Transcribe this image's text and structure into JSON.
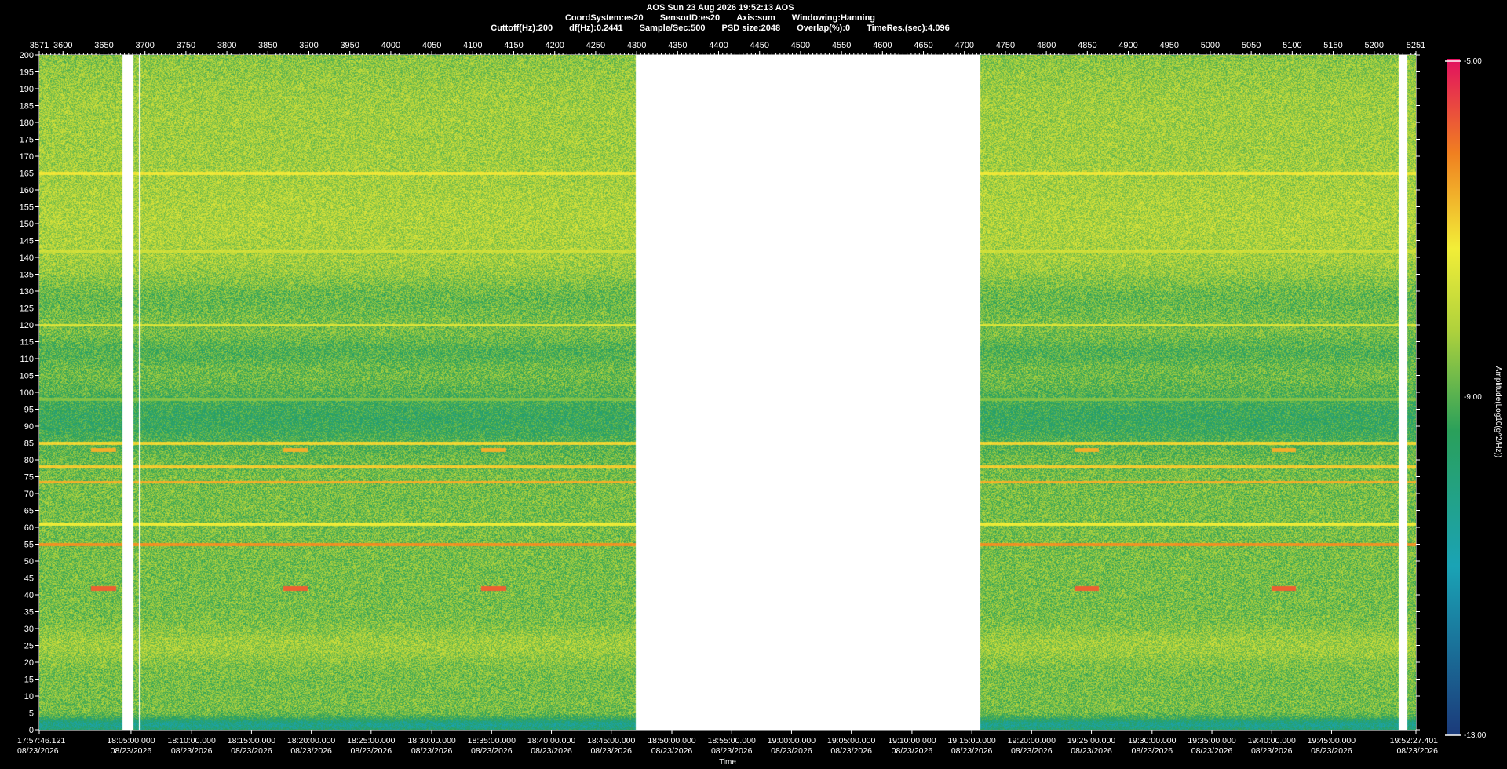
{
  "header": {
    "title": "AOS  Sun 23 Aug 2026 19:52:13  AOS",
    "row2": [
      "CoordSystem:es20",
      "SensorID:es20",
      "Axis:sum",
      "Windowing:Hanning"
    ],
    "row3": [
      "Cuttoff(Hz):200",
      "df(Hz):0.2441",
      "Sample/Sec:500",
      "PSD size:2048",
      "Overlap(%):0",
      "TimeRes.(sec):4.096"
    ]
  },
  "chart_data": {
    "type": "heatmap",
    "xlabel": "Time",
    "ylabel": "",
    "colorbar_label": "Amplitude(Log10(g^2/Hz))",
    "colorbar_ticks": [
      "-5.00",
      "-9.00",
      "-13.00"
    ],
    "zlim": [
      -13,
      -5
    ],
    "ylim": [
      0,
      200
    ],
    "y_ticks": [
      0,
      5,
      10,
      15,
      20,
      25,
      30,
      35,
      40,
      45,
      50,
      55,
      60,
      65,
      70,
      75,
      80,
      85,
      90,
      95,
      100,
      105,
      110,
      115,
      120,
      125,
      130,
      135,
      140,
      145,
      150,
      155,
      160,
      165,
      170,
      175,
      180,
      185,
      190,
      195,
      200
    ],
    "x_top_range": [
      3571,
      5251
    ],
    "x_top_ticks": [
      "3571",
      "3600",
      "3650",
      "3700",
      "3750",
      "3800",
      "3850",
      "3900",
      "3950",
      "4000",
      "4050",
      "4100",
      "4150",
      "4200",
      "4250",
      "4300",
      "4350",
      "4400",
      "4450",
      "4500",
      "4550",
      "4600",
      "4650",
      "4700",
      "4750",
      "4800",
      "4850",
      "4900",
      "4950",
      "5000",
      "5050",
      "5100",
      "5150",
      "5200",
      "5251"
    ],
    "x_bottom_ticks": [
      {
        "idx": 3571,
        "time": "17:57:46.121",
        "date": "08/23/2026"
      },
      {
        "idx": 3683,
        "time": "18:05:00.000",
        "date": "08/23/2026"
      },
      {
        "idx": 3757,
        "time": "18:10:00.000",
        "date": "08/23/2026"
      },
      {
        "idx": 3830,
        "time": "18:15:00.000",
        "date": "08/23/2026"
      },
      {
        "idx": 3903,
        "time": "18:20:00.000",
        "date": "08/23/2026"
      },
      {
        "idx": 3976,
        "time": "18:25:00.000",
        "date": "08/23/2026"
      },
      {
        "idx": 4050,
        "time": "18:30:00.000",
        "date": "08/23/2026"
      },
      {
        "idx": 4123,
        "time": "18:35:00.000",
        "date": "08/23/2026"
      },
      {
        "idx": 4196,
        "time": "18:40:00.000",
        "date": "08/23/2026"
      },
      {
        "idx": 4269,
        "time": "18:45:00.000",
        "date": "08/23/2026"
      },
      {
        "idx": 4343,
        "time": "18:50:00.000",
        "date": "08/23/2026"
      },
      {
        "idx": 4416,
        "time": "18:55:00.000",
        "date": "08/23/2026"
      },
      {
        "idx": 4489,
        "time": "19:00:00.000",
        "date": "08/23/2026"
      },
      {
        "idx": 4562,
        "time": "19:05:00.000",
        "date": "08/23/2026"
      },
      {
        "idx": 4636,
        "time": "19:10:00.000",
        "date": "08/23/2026"
      },
      {
        "idx": 4709,
        "time": "19:15:00.000",
        "date": "08/23/2026"
      },
      {
        "idx": 4782,
        "time": "19:20:00.000",
        "date": "08/23/2026"
      },
      {
        "idx": 4855,
        "time": "19:25:00.000",
        "date": "08/23/2026"
      },
      {
        "idx": 4929,
        "time": "19:30:00.000",
        "date": "08/23/2026"
      },
      {
        "idx": 5002,
        "time": "19:35:00.000",
        "date": "08/23/2026"
      },
      {
        "idx": 5075,
        "time": "19:40:00.000",
        "date": "08/23/2026"
      },
      {
        "idx": 5148,
        "time": "19:45:00.000",
        "date": "08/23/2026"
      },
      {
        "idx": 5251,
        "time": "19:52:27.401",
        "date": "08/23/2026"
      }
    ],
    "data_gaps": [
      [
        3672,
        3685
      ],
      [
        3692,
        3694
      ],
      [
        4298,
        4719
      ],
      [
        5229,
        5240
      ]
    ],
    "spectral_lines_hz": [
      {
        "hz": 165,
        "level": -7.2
      },
      {
        "hz": 142,
        "level": -7.8
      },
      {
        "hz": 120,
        "level": -7.6
      },
      {
        "hz": 98,
        "level": -8.6
      },
      {
        "hz": 85,
        "level": -7.0
      },
      {
        "hz": 78,
        "level": -6.9
      },
      {
        "hz": 73.5,
        "level": -6.6
      },
      {
        "hz": 61,
        "level": -7.3
      },
      {
        "hz": 55,
        "level": -6.3
      }
    ],
    "periodic_bursts": [
      {
        "idx_start": 3634,
        "idx_end": 3664,
        "hz": 42,
        "level": -5.8
      },
      {
        "idx_start": 3868,
        "idx_end": 3898,
        "hz": 42,
        "level": -5.8
      },
      {
        "idx_start": 4110,
        "idx_end": 4140,
        "hz": 42,
        "level": -5.8
      },
      {
        "idx_start": 4834,
        "idx_end": 4864,
        "hz": 42,
        "level": -5.8
      },
      {
        "idx_start": 5074,
        "idx_end": 5104,
        "hz": 42,
        "level": -5.8
      }
    ]
  }
}
